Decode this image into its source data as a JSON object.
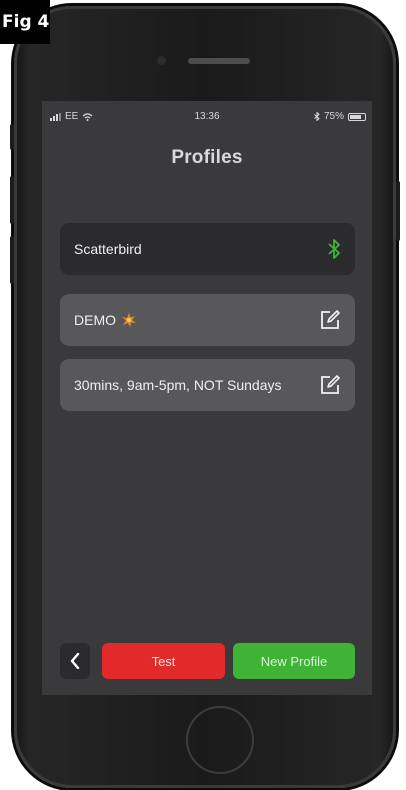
{
  "figure_label": "Fig 4",
  "status_bar": {
    "carrier": "EE",
    "time": "13:36",
    "battery": "75%",
    "icons": [
      "signal-icon",
      "wifi-icon",
      "bluetooth-icon",
      "battery-icon"
    ]
  },
  "header": {
    "title": "Profiles"
  },
  "device": {
    "name": "Scatterbird",
    "icon": "bluetooth-icon",
    "icon_color": "#3fb53a"
  },
  "profiles": [
    {
      "label": "DEMO",
      "badge_icon": "burst-icon",
      "action_icon": "edit-icon"
    },
    {
      "label": "30mins, 9am-5pm, NOT Sundays",
      "action_icon": "edit-icon"
    }
  ],
  "bottom_bar": {
    "back_icon": "chevron-left-icon",
    "test_label": "Test",
    "new_profile_label": "New Profile"
  },
  "colors": {
    "test_button": "#e32a2a",
    "new_profile_button": "#3eb335",
    "screen_background": "#3a3a3c"
  }
}
